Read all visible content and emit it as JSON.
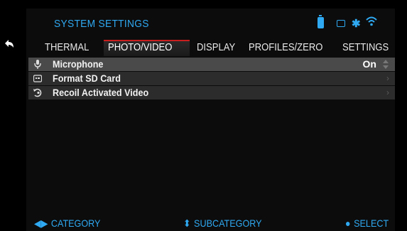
{
  "header": {
    "title": "SYSTEM SETTINGS",
    "status_icons": [
      "battery-icon",
      "sd-card-icon",
      "bluetooth-icon",
      "wifi-icon"
    ]
  },
  "tabs": [
    {
      "label": "THERMAL",
      "active": false
    },
    {
      "label": "PHOTO/VIDEO",
      "active": true
    },
    {
      "label": "DISPLAY",
      "active": false
    },
    {
      "label": "PROFILES/ZERO",
      "active": false
    },
    {
      "label": "SETTINGS",
      "active": false
    }
  ],
  "rows": [
    {
      "label": "Microphone",
      "icon": "microphone-icon",
      "value": "On",
      "selected": true
    },
    {
      "label": "Format SD Card",
      "icon": "sd-card-icon",
      "value": "",
      "selected": false
    },
    {
      "label": "Recoil Activated Video",
      "icon": "recoil-video-icon",
      "value": "",
      "selected": false
    }
  ],
  "footer": {
    "category": "CATEGORY",
    "subcategory": "SUBCATEGORY",
    "select": "SELECT"
  },
  "colors": {
    "accent": "#2fa9f2",
    "tab_indicator": "#c81e1e",
    "row_bg": "#2c2c2c",
    "row_selected_bg": "#4a4a4a"
  }
}
